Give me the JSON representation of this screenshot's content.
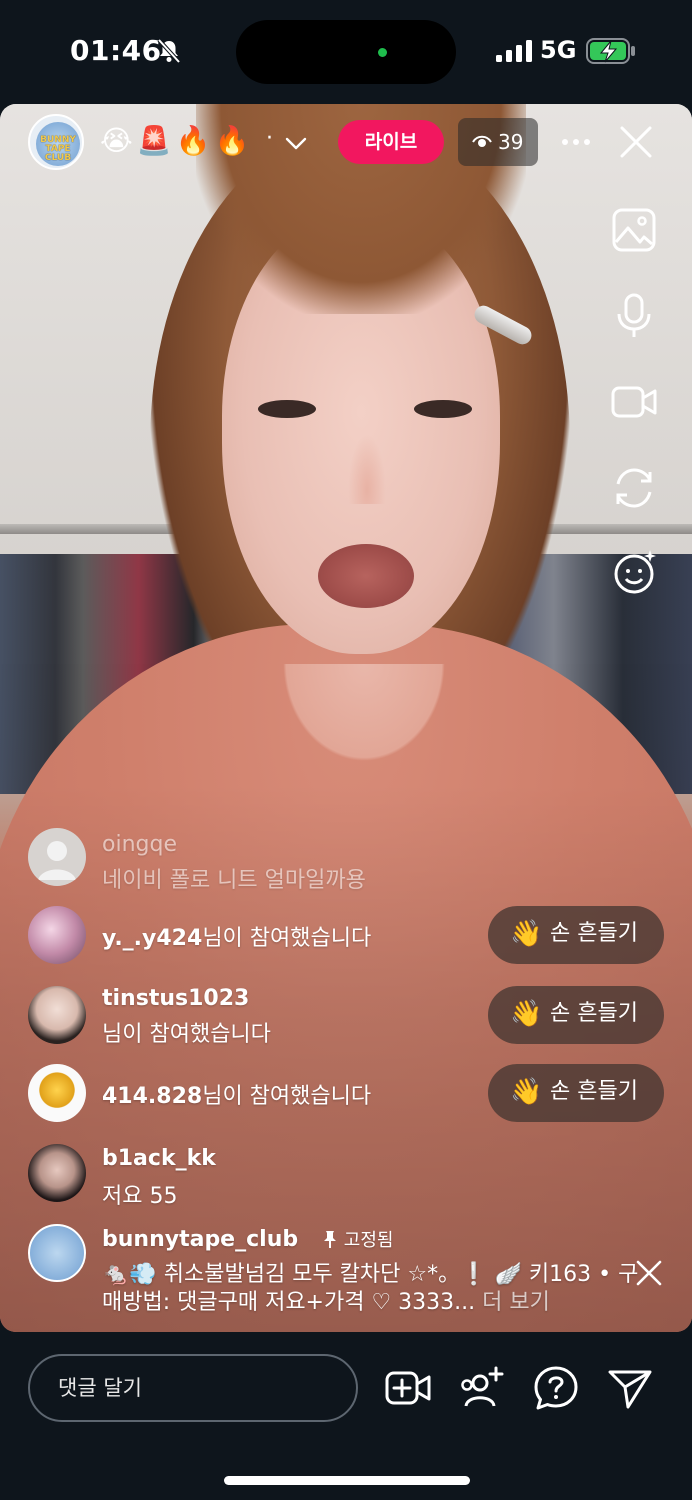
{
  "status_bar": {
    "time": "01:46",
    "network": "5G"
  },
  "header": {
    "host_logo_text": "BUNNY TAPE CLUB",
    "title_emojis": "😭🚨🔥🔥",
    "title_separator": "·",
    "live_label": "라이브",
    "viewer_count": "39",
    "live_color": "#f2175f"
  },
  "side_tools": [
    "gallery-icon",
    "microphone-icon",
    "video-camera-icon",
    "flip-camera-icon",
    "effects-face-icon"
  ],
  "comments": [
    {
      "username": "oingqe",
      "message": "네이비 폴로 니트 얼마일까용",
      "faded": true
    },
    {
      "username": "y._.y424",
      "message": "님이 참여했습니다",
      "wave": "손 흔들기"
    },
    {
      "username": "tinstus1023",
      "message": "님이 참여했습니다",
      "wave": "손 흔들기"
    },
    {
      "username": "414.828",
      "message": "님이 참여했습니다",
      "wave": "손 흔들기"
    },
    {
      "username": "b1ack_kk",
      "message": "저요 55"
    },
    {
      "username": "bunnytape_club",
      "pinned_label": "고정됨",
      "message_line1": "🐁💨 취소불발넘김 모두 칼차단 ☆*。❕ 🪽 키163 • 구",
      "message_line2": "매방법: 댓글구매 저요+가격 ♡ 3333...",
      "more_label": "더 보기"
    }
  ],
  "wave_hand": "👋",
  "bottom_bar": {
    "comment_placeholder": "댓글 달기"
  }
}
